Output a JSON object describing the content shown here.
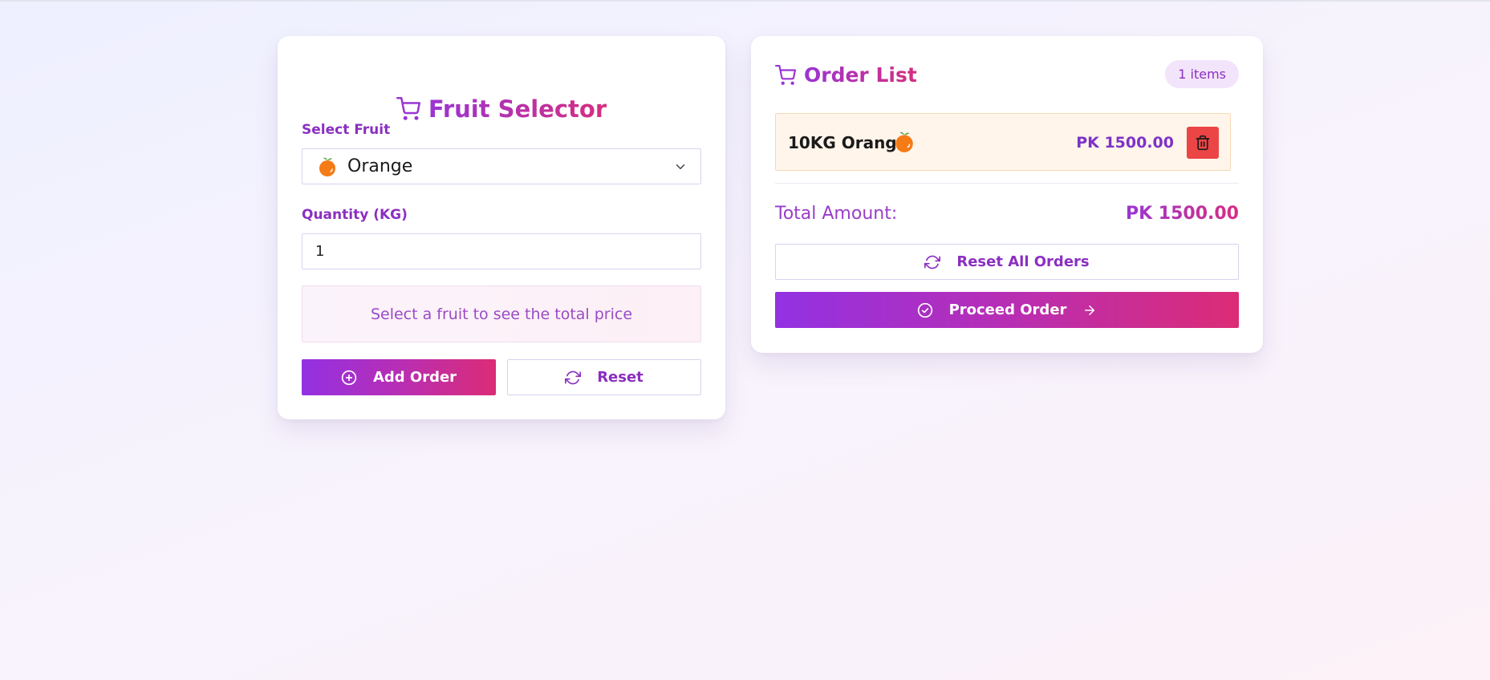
{
  "colors": {
    "accent_purple": "#8b2fc0",
    "gradient_start": "#9331e3",
    "gradient_end": "#dc2c76",
    "delete_red": "#ec4545",
    "orange": "#f47b16"
  },
  "selector": {
    "icon": "cart-icon",
    "title": "Fruit Selector",
    "fruit_label": "Select Fruit",
    "selected_fruit": "Orange",
    "selected_fruit_icon": "orange-fruit-icon",
    "quantity_label": "Quantity (KG)",
    "quantity_value": "1",
    "price_hint": "Select a fruit to see the total price",
    "add_button": "Add Order",
    "add_icon": "plus-circle-icon",
    "reset_button": "Reset",
    "reset_icon": "refresh-icon"
  },
  "orders": {
    "icon": "cart-icon",
    "title": "Order List",
    "count_badge": "1 items",
    "items": [
      {
        "name": "10KG Orange",
        "icon": "orange-fruit-icon",
        "price": "PK 1500.00",
        "delete_icon": "trash-icon"
      }
    ],
    "total_label": "Total Amount:",
    "total_value": "PK 1500.00",
    "reset_all_button": "Reset All Orders",
    "reset_all_icon": "refresh-icon",
    "proceed_button": "Proceed Order",
    "proceed_icon": "check-circle-icon",
    "proceed_arrow_icon": "arrow-right-icon"
  }
}
